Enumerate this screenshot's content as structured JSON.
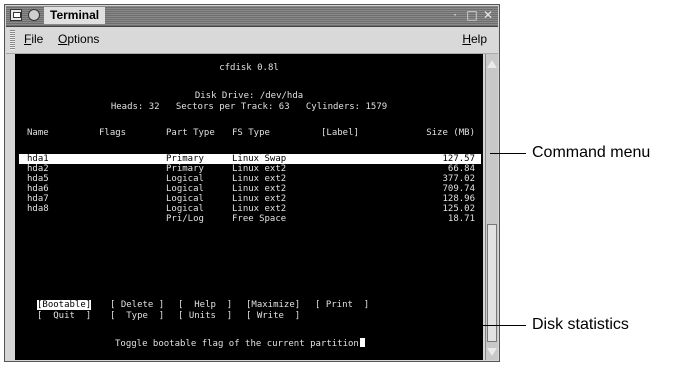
{
  "window": {
    "title": "Terminal",
    "title_buttons": {
      "minimize": "·",
      "maximize": "□",
      "close": "✕"
    }
  },
  "menubar": {
    "file": "File",
    "options": "Options",
    "help": "Help"
  },
  "terminal": {
    "program": "cfdisk 0.8l",
    "disk_drive": "Disk Drive: /dev/hda",
    "geometry": "Heads: 32   Sectors per Track: 63   Cylinders: 1579",
    "columns": [
      "Name",
      "Flags",
      "Part Type",
      "FS Type",
      "[Label]",
      "Size (MB)"
    ],
    "partitions": [
      {
        "name": "hda1",
        "flags": "",
        "part_type": "Primary",
        "fs_type": "Linux Swap",
        "label": "",
        "size": "127.57"
      },
      {
        "name": "hda2",
        "flags": "",
        "part_type": "Primary",
        "fs_type": "Linux ext2",
        "label": "",
        "size": "66.84"
      },
      {
        "name": "hda5",
        "flags": "",
        "part_type": "Logical",
        "fs_type": "Linux ext2",
        "label": "",
        "size": "377.02"
      },
      {
        "name": "hda6",
        "flags": "",
        "part_type": "Logical",
        "fs_type": "Linux ext2",
        "label": "",
        "size": "709.74"
      },
      {
        "name": "hda7",
        "flags": "",
        "part_type": "Logical",
        "fs_type": "Linux ext2",
        "label": "",
        "size": "128.96"
      },
      {
        "name": "hda8",
        "flags": "",
        "part_type": "Logical",
        "fs_type": "Linux ext2",
        "label": "",
        "size": "125.02"
      },
      {
        "name": "",
        "flags": "",
        "part_type": "Pri/Log",
        "fs_type": "Free Space",
        "label": "",
        "size": "18.71"
      }
    ],
    "selected_partition": "hda1",
    "commands_row1": [
      "[Bootable]",
      "[ Delete ]",
      "[  Help  ]",
      "[Maximize]",
      "[ Print  ]"
    ],
    "commands_row2": [
      "[  Quit  ]",
      "[  Type  ]",
      "[ Units  ]",
      "[ Write  ]"
    ],
    "selected_command": "[Bootable]",
    "status": "Toggle bootable flag of the current partition"
  },
  "callouts": {
    "command_menu": "Command menu",
    "disk_statistics": "Disk statistics"
  }
}
